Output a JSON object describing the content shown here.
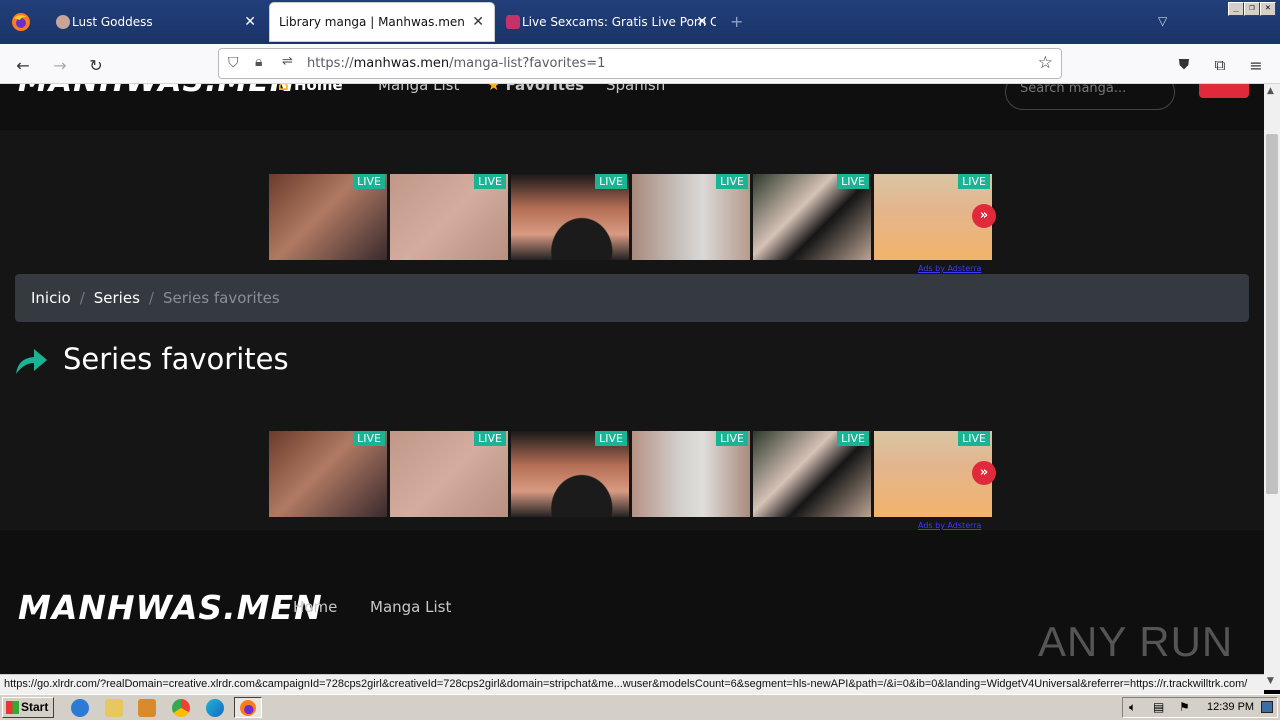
{
  "browser": {
    "tabs": [
      {
        "title": "Lust Goddess",
        "active": false
      },
      {
        "title": "Library manga | Manhwas.men",
        "active": true
      },
      {
        "title": "Live Sexcams: Gratis Live Porn Cha",
        "active": false
      }
    ],
    "new_tab": "+",
    "url_prefix": "https://",
    "url_domain": "manhwas.men",
    "url_path": "/manga-list?favorites=1",
    "status_url": "https://go.xlrdr.com/?realDomain=creative.xlrdr.com&campaignId=728cps2girl&creativeId=728cps2girl&domain=stripchat&me...wuser&modelsCount=6&segment=hls-newAPI&path=/&i=0&ib=0&landing=WidgetV4Universal&referrer=https://r.trackwilltrk.com/"
  },
  "site": {
    "logo": "MANHWAS.MEN",
    "nav": [
      "Home",
      "Manga List",
      "Favorites",
      "Spanish"
    ],
    "search_placeholder": "Search manga...",
    "breadcrumb": [
      "Inicio",
      "Series",
      "Series favorites"
    ],
    "page_title": "Series favorites",
    "ad_live_label": "LIVE",
    "ad_more": "»",
    "ads_by": "Ads by Adsterra",
    "footer_nav": [
      "Home",
      "Manga List"
    ],
    "watermark": "ANY RUN"
  },
  "taskbar": {
    "start": "Start",
    "clock": "12:39 PM"
  },
  "colors": {
    "accent_red": "#e0293a",
    "live_green": "#1ab394",
    "arrow_green": "#1ab394"
  }
}
